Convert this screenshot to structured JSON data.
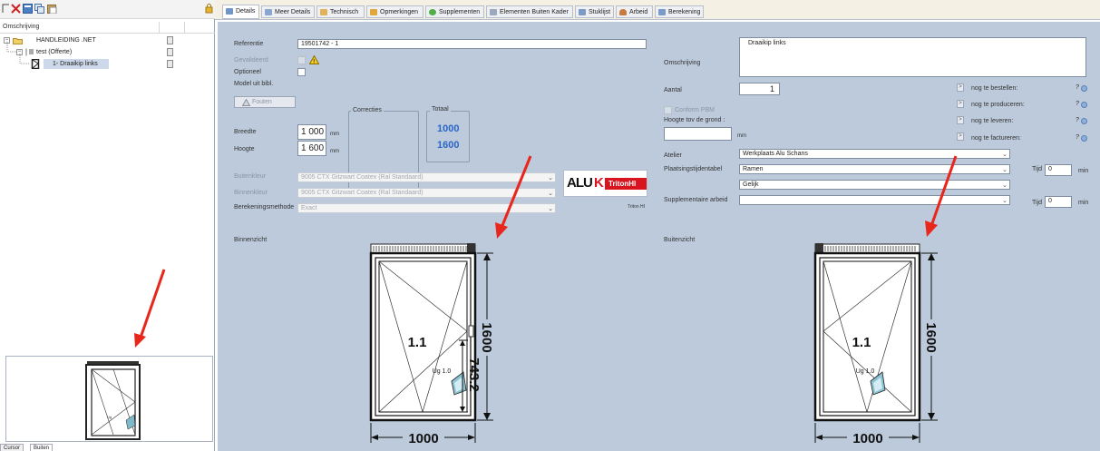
{
  "left_panel": {
    "column_header": "Omschrijving",
    "tree": [
      {
        "label": "HANDLEIDING .NET"
      },
      {
        "label": "test (Offerte)"
      },
      {
        "label": "1- Draaikip links"
      }
    ],
    "bottom_tabs": [
      "Cursor",
      "Buiten"
    ]
  },
  "tabs": [
    {
      "label": "Details",
      "active": true
    },
    {
      "label": "Meer Details"
    },
    {
      "label": "Technisch"
    },
    {
      "label": "Opmerkingen"
    },
    {
      "label": "Supplementen"
    },
    {
      "label": "Elementen Buiten Kader"
    },
    {
      "label": "Stuklijst"
    },
    {
      "label": "Arbeid"
    },
    {
      "label": "Berekening"
    }
  ],
  "details": {
    "referentie_label": "Referentie",
    "referentie_value": "19501742 - 1",
    "gevalideerd_label": "Gevalideerd",
    "optioneel_label": "Optioneel",
    "model_label": "Model uit bibl.",
    "fouten_button": "Fouten",
    "correcties_label": "Correcties",
    "totaal_label": "Totaal",
    "breedte_label": "Breedte",
    "breedte_value": "1 000",
    "hoogte_label": "Hoogte",
    "hoogte_value": "1 600",
    "unit_mm": "mm",
    "totaal_breedte": "1000",
    "totaal_hoogte": "1600",
    "buitenkleur_label": "Buitenkleur",
    "buitenkleur_value": "9005 CTX Gitzwart Coatex (Ral Standaard)",
    "binnenkleur_label": "Binnenkleur",
    "binnenkleur_value": "9005 CTX Gitzwart Coatex (Ral Standaard)",
    "berekeningsmethode_label": "Berekeningsmethode",
    "berekeningsmethode_value": "Exact",
    "logo_text_1": "ALU",
    "logo_text_2": "K",
    "logo_text_3": "TritonHI",
    "logo_caption": "Triton HI",
    "binnenzicht_label": "Binnenzicht",
    "buitenzicht_label": "Buitenzicht"
  },
  "right_form": {
    "omschrijving_label": "Omschrijving",
    "omschrijving_value": "Draaikip links",
    "aantal_label": "Aantal",
    "aantal_value": "1",
    "conform_pbm_label": "Conform PBM",
    "hoogte_grond_label": "Hoogte tov de grond :",
    "unit_mm": "mm",
    "status_rows": [
      {
        "label": "nog te bestellen:",
        "value": "?"
      },
      {
        "label": "nog te produceren:",
        "value": "?"
      },
      {
        "label": "nog te leveren:",
        "value": "?"
      },
      {
        "label": "nog te factureren:",
        "value": "?"
      }
    ],
    "atelier_label": "Atelier",
    "atelier_value": "Werkplaats Alu Schans",
    "plaatsings_label": "Plaatsingstijdentabel",
    "plaatsings_value": "Ramen",
    "gelijk_value": "Gelijk",
    "supplementaire_label": "Supplementaire arbeid",
    "tijd_label": "Tijd",
    "tijd_value_1": "0",
    "tijd_value_2": "0",
    "min_label": "min"
  },
  "drawing": {
    "sash_label": "1.1",
    "ug_label": "Ug 1.0",
    "width_dim": "1000",
    "height_dim": "1600",
    "handle_dim": "743.2"
  },
  "colors": {
    "content_bg": "#bccadb",
    "arrow": "#e8261c",
    "logo_red": "#d8141f"
  }
}
